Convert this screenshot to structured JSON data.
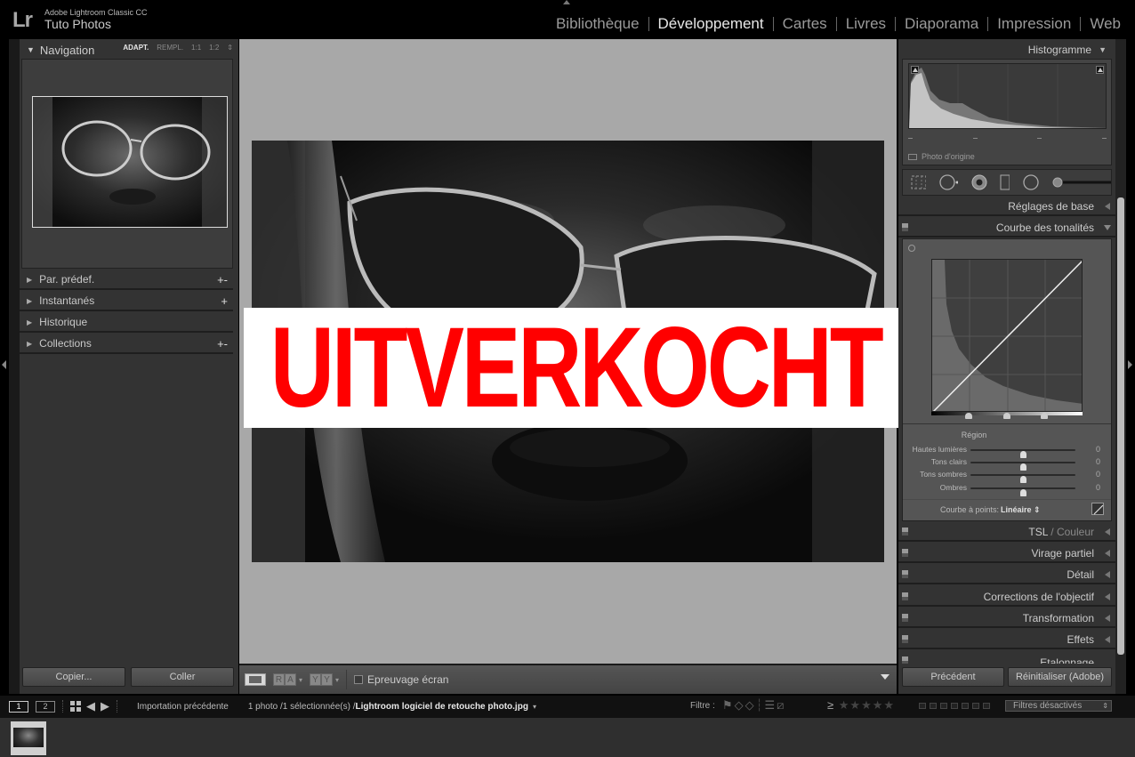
{
  "app": {
    "logo": "Lr",
    "product": "Adobe Lightroom Classic CC",
    "catalog": "Tuto Photos"
  },
  "modules": [
    {
      "label": "Bibliothèque",
      "active": false
    },
    {
      "label": "Développement",
      "active": true
    },
    {
      "label": "Cartes",
      "active": false
    },
    {
      "label": "Livres",
      "active": false
    },
    {
      "label": "Diaporama",
      "active": false
    },
    {
      "label": "Impression",
      "active": false
    },
    {
      "label": "Web",
      "active": false
    }
  ],
  "left_panel": {
    "navigator": {
      "title": "Navigation",
      "zoom_options": [
        "ADAPT.",
        "REMPL.",
        "1:1",
        "1:2"
      ],
      "active_zoom": "ADAPT."
    },
    "sections": [
      {
        "label": "Par. prédef.",
        "action": "+-"
      },
      {
        "label": "Instantanés",
        "action": "+"
      },
      {
        "label": "Historique",
        "action": ""
      },
      {
        "label": "Collections",
        "action": "+-"
      }
    ],
    "buttons": {
      "copy": "Copier...",
      "paste": "Coller"
    }
  },
  "overlay": {
    "text": "UITVERKOCHT",
    "text_color": "#ff0000",
    "background": "#ffffff"
  },
  "toolbar": {
    "view_pair_1": [
      "R",
      "A"
    ],
    "view_pair_2": [
      "Y",
      "Y"
    ],
    "soft_proof_label": "Epreuvage écran",
    "soft_proof_checked": false
  },
  "right_panel": {
    "histogram": {
      "title": "Histogramme",
      "original_photo_label": "Photo d'origine"
    },
    "sections_top": [
      {
        "label": "Réglages de base",
        "expanded": false
      }
    ],
    "tone_curve": {
      "title": "Courbe des tonalités",
      "region_label": "Région",
      "sliders": [
        {
          "label": "Hautes lumières",
          "value": 0
        },
        {
          "label": "Tons clairs",
          "value": 0
        },
        {
          "label": "Tons sombres",
          "value": 0
        },
        {
          "label": "Ombres",
          "value": 0
        }
      ],
      "point_curve_label": "Courbe à points:",
      "point_curve_value": "Linéaire"
    },
    "sections_bottom": [
      {
        "label": "TSL",
        "secondary": "Couleur"
      },
      {
        "label": "Virage partiel",
        "secondary": ""
      },
      {
        "label": "Détail",
        "secondary": ""
      },
      {
        "label": "Corrections de l'objectif",
        "secondary": ""
      },
      {
        "label": "Transformation",
        "secondary": ""
      },
      {
        "label": "Effets",
        "secondary": ""
      },
      {
        "label": "Etalonnage",
        "secondary": ""
      }
    ],
    "buttons": {
      "previous": "Précédent",
      "reset": "Réinitialiser (Adobe)"
    }
  },
  "filmstrip_bar": {
    "monitor_1": "1",
    "monitor_2": "2",
    "source": "Importation précédente",
    "count": "1 photo /1 sélectionnée(s) /",
    "filename": "Lightroom logiciel de retouche photo.jpg",
    "filter_label": "Filtre :",
    "rating_operator": "≥",
    "stars": "★★★★★",
    "filter_preset": "Filtres désactivés"
  }
}
